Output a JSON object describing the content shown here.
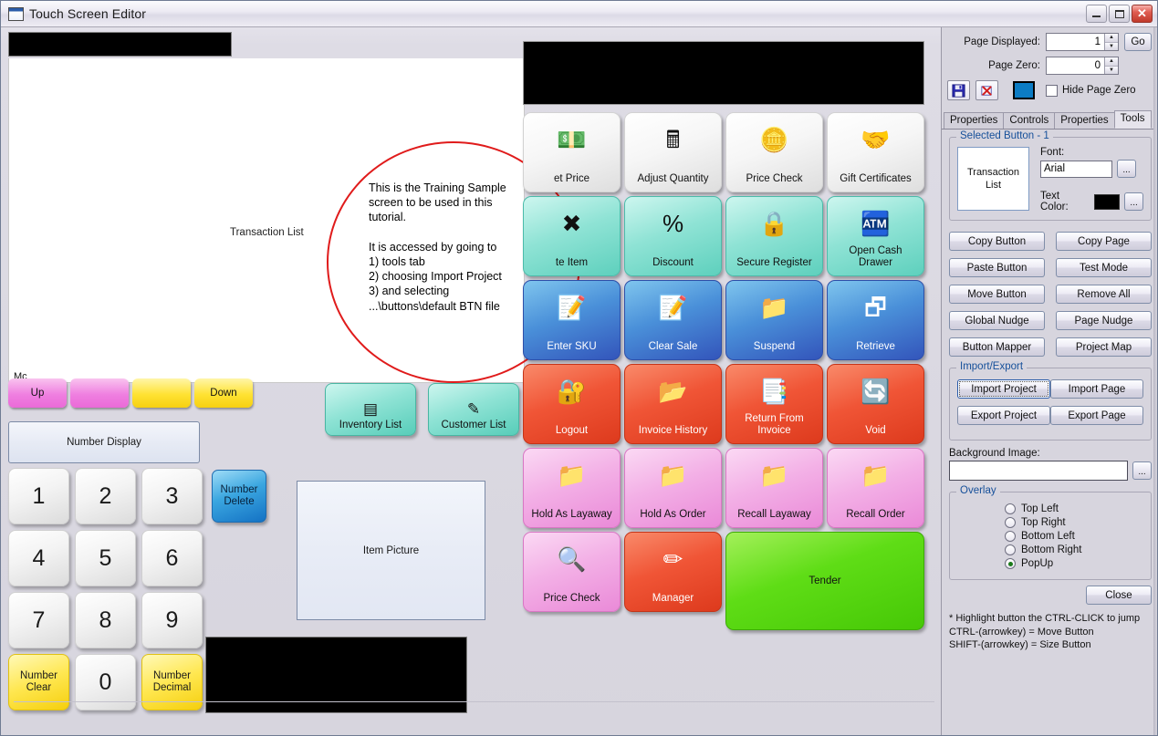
{
  "window": {
    "title": "Touch Screen Editor",
    "minimize_label": "–",
    "maximize_label": "□",
    "close_label": "✕"
  },
  "canvas": {
    "transaction_list_label": "Transaction List",
    "mc_label": "Mc",
    "number_display_label": "Number Display",
    "item_picture_label": "Item Picture",
    "callout_text": "This is the Training Sample\nscreen to be used in this\ntutorial.\n\nIt is accessed by going to\n1) tools tab\n2) choosing Import Project\n3) and selecting\n...\\buttons\\default BTN file",
    "updown_buttons": [
      {
        "label": "Up",
        "color": "pink"
      },
      {
        "label": "",
        "color": "pink"
      },
      {
        "label": "",
        "color": "yellow"
      },
      {
        "label": "Down",
        "color": "yellow"
      }
    ],
    "keypad": [
      [
        {
          "label": "1",
          "style": "num"
        },
        {
          "label": "2",
          "style": "num"
        },
        {
          "label": "3",
          "style": "num"
        }
      ],
      [
        {
          "label": "4",
          "style": "num"
        },
        {
          "label": "5",
          "style": "num"
        },
        {
          "label": "6",
          "style": "num"
        }
      ],
      [
        {
          "label": "7",
          "style": "num"
        },
        {
          "label": "8",
          "style": "num"
        },
        {
          "label": "9",
          "style": "num"
        }
      ],
      [
        {
          "label": "Number\nClear",
          "style": "yellow"
        },
        {
          "label": "0",
          "style": "num"
        },
        {
          "label": "Number\nDecimal",
          "style": "yellow"
        }
      ]
    ],
    "number_delete_label": "Number\nDelete",
    "list_buttons": [
      {
        "label": "Inventory List",
        "icon": "inventory-list-icon",
        "glyph": "▤"
      },
      {
        "label": "Customer List",
        "icon": "customer-list-icon",
        "glyph": "✎"
      }
    ]
  },
  "pos_grid": {
    "rows": [
      [
        {
          "label": "et Price",
          "color": "white",
          "icon": "money-icon",
          "glyph": "💵"
        },
        {
          "label": "Adjust Quantity",
          "color": "white",
          "icon": "calculator-icon",
          "glyph": "🖩"
        },
        {
          "label": "Price Check",
          "color": "white",
          "icon": "coin-icon",
          "glyph": "🪙"
        },
        {
          "label": "Gift Certificates",
          "color": "white",
          "icon": "gift-certificate-icon",
          "glyph": "🤝"
        }
      ],
      [
        {
          "label": "te Item",
          "color": "teal",
          "icon": "delete-item-icon",
          "glyph": "✖"
        },
        {
          "label": "Discount",
          "color": "teal",
          "icon": "percent-icon",
          "glyph": "%"
        },
        {
          "label": "Secure Register",
          "color": "teal",
          "icon": "lock-icon",
          "glyph": "🔒"
        },
        {
          "label": "Open Cash\nDrawer",
          "color": "teal",
          "icon": "cash-register-icon",
          "glyph": "🏧"
        }
      ],
      [
        {
          "label": "Enter SKU",
          "color": "blue",
          "icon": "enter-sku-icon",
          "glyph": "📝"
        },
        {
          "label": "Clear Sale",
          "color": "blue",
          "icon": "clear-sale-icon",
          "glyph": "📝"
        },
        {
          "label": "Suspend",
          "color": "blue",
          "icon": "suspend-folder-icon",
          "glyph": "📁"
        },
        {
          "label": "Retrieve",
          "color": "blue",
          "icon": "retrieve-windows-icon",
          "glyph": "🗗"
        }
      ],
      [
        {
          "label": "Logout",
          "color": "red",
          "icon": "lock-key-icon",
          "glyph": "🔐"
        },
        {
          "label": "Invoice History",
          "color": "red",
          "icon": "folder-open-icon",
          "glyph": "📂"
        },
        {
          "label": "Return From\nInvoice",
          "color": "red",
          "icon": "return-invoice-icon",
          "glyph": "📑"
        },
        {
          "label": "Void",
          "color": "red",
          "icon": "void-arrows-icon",
          "glyph": "🔄"
        }
      ],
      [
        {
          "label": "Hold As Layaway",
          "color": "pink",
          "icon": "folder-icon",
          "glyph": "📁"
        },
        {
          "label": "Hold As Order",
          "color": "pink",
          "icon": "folder-icon",
          "glyph": "📁"
        },
        {
          "label": "Recall Layaway",
          "color": "pink",
          "icon": "folder-icon",
          "glyph": "📁"
        },
        {
          "label": "Recall Order",
          "color": "pink",
          "icon": "folder-icon",
          "glyph": "📁"
        }
      ],
      [
        {
          "label": "Price Check",
          "color": "pink",
          "icon": "price-check-icon",
          "glyph": "🔍"
        },
        {
          "label": "Manager",
          "color": "red",
          "icon": "manager-pencil-icon",
          "glyph": "✏"
        },
        {
          "label": "Tender",
          "color": "green",
          "icon": "",
          "glyph": "",
          "wide": true
        }
      ]
    ]
  },
  "right_panel": {
    "page_displayed_label": "Page Displayed:",
    "page_displayed_value": "1",
    "page_zero_label": "Page Zero:",
    "page_zero_value": "0",
    "go_label": "Go",
    "save_icon": "save-disk-icon",
    "delete_icon": "delete-x-icon",
    "color_swatch": "#0c7cc4",
    "hide_page_zero_label": "Hide Page Zero",
    "tabs": [
      {
        "label": "Properties",
        "active": false
      },
      {
        "label": "Controls",
        "active": false
      },
      {
        "label": "Properties",
        "active": false
      },
      {
        "label": "Tools",
        "active": true
      }
    ],
    "selected_button": {
      "group_title": "Selected Button - 1",
      "preview_label": "Transaction\nList",
      "font_label": "Font:",
      "font_value": "Arial",
      "text_color_label": "Text Color:",
      "text_color": "#000000",
      "browse_label": "..."
    },
    "action_buttons": [
      [
        "Copy Button",
        "Copy Page"
      ],
      [
        "Paste Button",
        "Test Mode"
      ],
      [
        "Move Button",
        "Remove All"
      ],
      [
        "Global Nudge",
        "Page Nudge"
      ],
      [
        "Button Mapper",
        "Project Map"
      ]
    ],
    "import_export": {
      "group_title": "Import/Export",
      "buttons": [
        [
          "Import Project",
          "Import Page"
        ],
        [
          "Export Project",
          "Export Page"
        ]
      ],
      "focused": "Import Project"
    },
    "background_image_label": "Background Image:",
    "background_image_value": "",
    "browse_label": "...",
    "overlay": {
      "group_title": "Overlay",
      "options": [
        {
          "label": "Top Left",
          "selected": false
        },
        {
          "label": "Top Right",
          "selected": false
        },
        {
          "label": "Bottom Left",
          "selected": false
        },
        {
          "label": "Bottom Right",
          "selected": false
        },
        {
          "label": "PopUp",
          "selected": true
        }
      ]
    },
    "close_label": "Close",
    "hints_text": "* Highlight button the CTRL-CLICK to jump\nCTRL-(arrowkey) = Move Button\nSHIFT-(arrowkey) = Size Button"
  }
}
